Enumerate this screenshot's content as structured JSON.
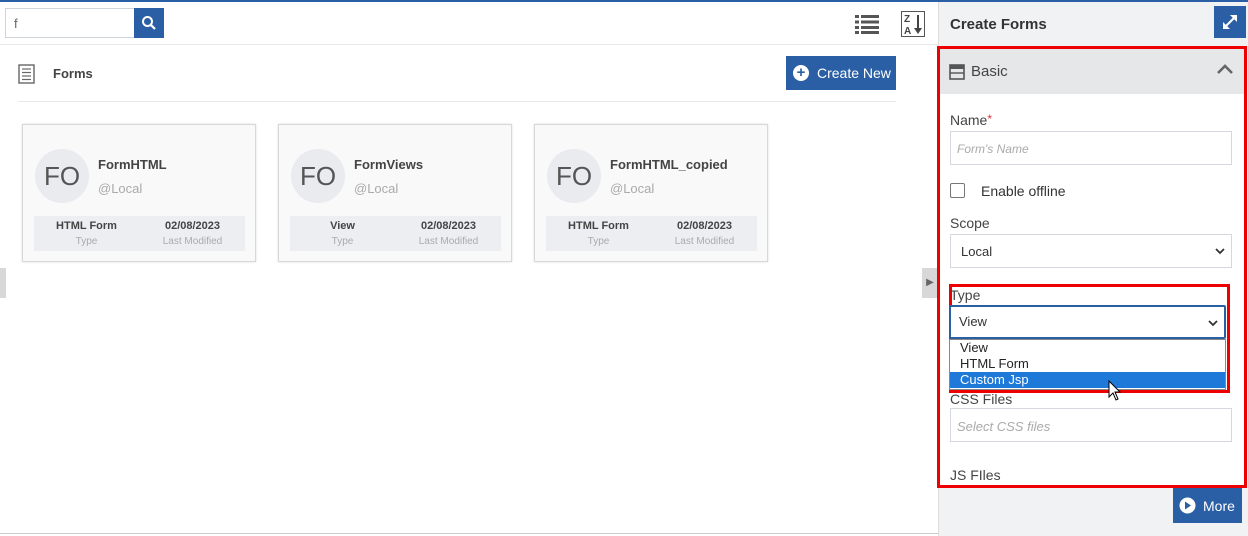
{
  "search": {
    "value": "f"
  },
  "page": {
    "title": "Forms",
    "create_label": "Create New"
  },
  "cards": [
    {
      "initials": "FO",
      "name": "FormHTML",
      "location": "@Local",
      "type": "HTML Form",
      "type_label": "Type",
      "modified": "02/08/2023",
      "modified_label": "Last Modified"
    },
    {
      "initials": "FO",
      "name": "FormViews",
      "location": "@Local",
      "type": "View",
      "type_label": "Type",
      "modified": "02/08/2023",
      "modified_label": "Last Modified"
    },
    {
      "initials": "FO",
      "name": "FormHTML_copied",
      "location": "@Local",
      "type": "HTML Form",
      "type_label": "Type",
      "modified": "02/08/2023",
      "modified_label": "Last Modified"
    }
  ],
  "panel": {
    "title": "Create Forms",
    "section_title": "Basic",
    "name_label": "Name",
    "name_required": "*",
    "name_placeholder": "Form's Name",
    "offline_label": "Enable offline",
    "scope_label": "Scope",
    "scope_value": "Local",
    "type_label": "Type",
    "type_value": "View",
    "type_options": [
      "View",
      "HTML Form",
      "Custom Jsp"
    ],
    "css_label": "CSS Files",
    "css_placeholder": "Select CSS files",
    "js_label": "JS FIles",
    "more_label": "More"
  },
  "colors": {
    "accent": "#2a5fa5",
    "highlight": "#e00000",
    "selected_option": "#1e79d8"
  }
}
